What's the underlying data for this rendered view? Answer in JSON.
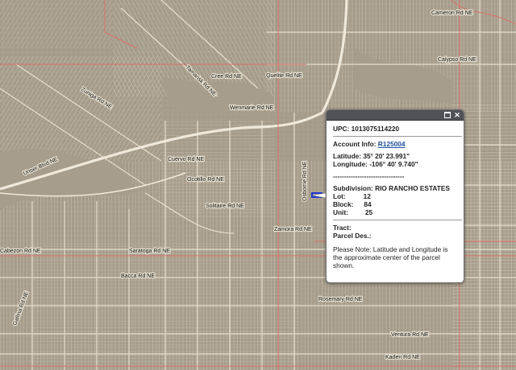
{
  "map": {
    "street_labels": [
      "Cameron Rd NE",
      "Calypso Rd NE",
      "Cree Rd NE",
      "Quelite Rd NE",
      "Wenmarie Rd NE",
      "Unser Blvd NE",
      "Zamora Rd NE",
      "Ocotillo Rd NE",
      "Saratoga Rd NE",
      "Solitaire Rd NE",
      "Rosemary Rd NE",
      "Ventura Rd NE",
      "Kaden Rd NE",
      "Bacca Rd NE",
      "Zuniga Rd NE",
      "Gallina Rd NE",
      "Cabezon Rd NE",
      "Cuervo Rd NE",
      "Osborne Rd NE",
      "Tamarisk Rd NE"
    ],
    "colors": {
      "terrain": "#a79d8c",
      "lot_lines": "#e3dccb",
      "parcel_boundary": "#d96e64",
      "road": "#efe9db",
      "selection": "#1f35d6"
    }
  },
  "popup": {
    "upc_text": "UPC: 1013075114220",
    "account_label": "Account Info:",
    "account_value": "R125004",
    "latitude_text": "Latitude: 35° 20' 23.991\"",
    "longitude_text": "Longitude: -106° 40' 9.740\"",
    "separator_text": "--------------------------------",
    "subdivision_label": "Subdivision:",
    "subdivision_value": "RIO RANCHO ESTATES",
    "lot_label": "Lot:",
    "lot_value": "12",
    "block_label": "Block:",
    "block_value": "84",
    "unit_label": "Unit:",
    "unit_value": "25",
    "tract_label": "Tract:",
    "parcel_des_label": "Parcel Des.:",
    "note": "Please Note: Latitude and Longitude is the approximate center of the parcel shown.",
    "icons": [
      "maximize-icon",
      "close-icon"
    ]
  }
}
